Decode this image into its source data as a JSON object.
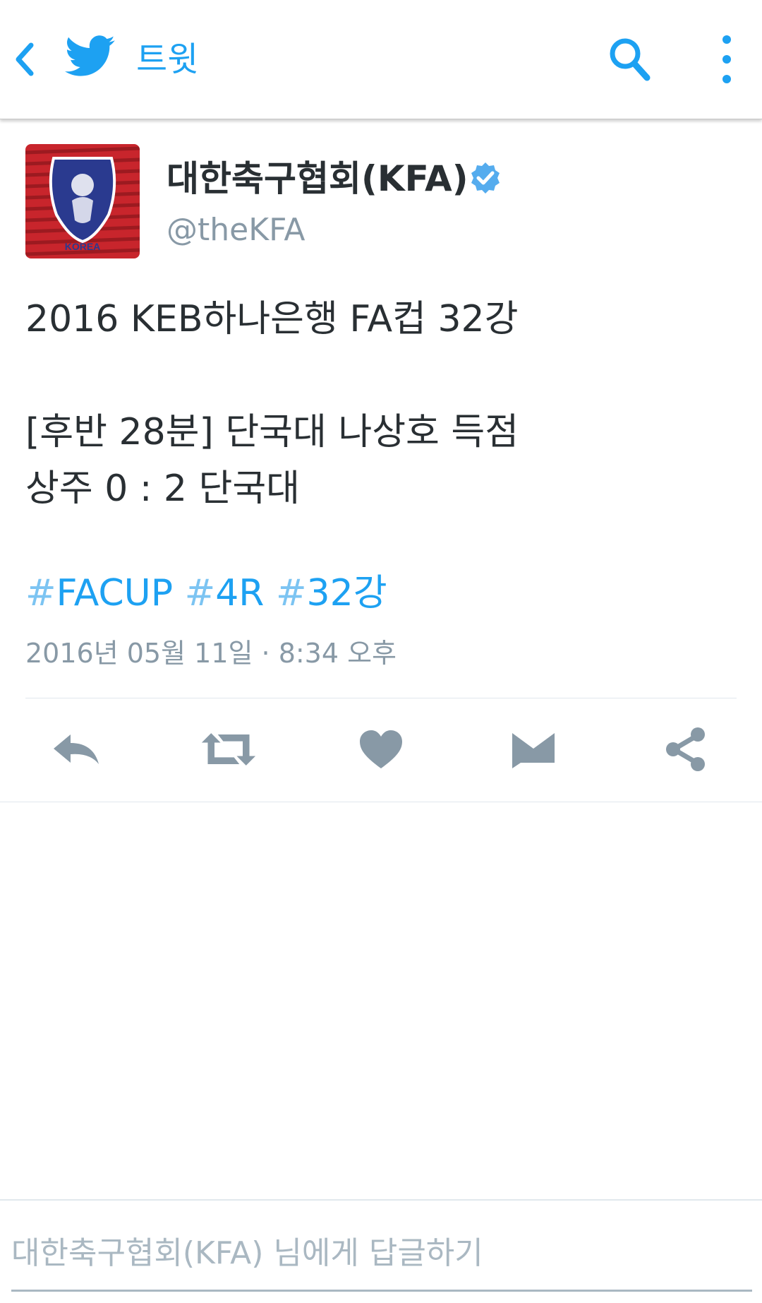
{
  "app": {
    "screen_title": "트윗",
    "accent_color": "#1da1f2"
  },
  "tweet": {
    "author_name": "대한축구협회(KFA)",
    "handle": "@theKFA",
    "verified": true,
    "avatar_text": "KOREA",
    "text_lines": [
      "2016 KEB하나은행 FA컵 32강",
      "[후반 28분] 단국대 나상호 득점",
      "상주 0 : 2 단국대"
    ],
    "hashtags": [
      {
        "hash": "#",
        "tag": "FACUP"
      },
      {
        "hash": "#",
        "tag": "4R"
      },
      {
        "hash": "#",
        "tag": "32강"
      }
    ],
    "timestamp": "2016년 05월 11일 · 8:34 오후"
  },
  "actions": [
    {
      "name": "reply",
      "icon": "reply-icon"
    },
    {
      "name": "retweet",
      "icon": "retweet-icon"
    },
    {
      "name": "like",
      "icon": "heart-icon"
    },
    {
      "name": "direct-message",
      "icon": "envelope-icon"
    },
    {
      "name": "share",
      "icon": "share-icon"
    }
  ],
  "reply_box": {
    "placeholder": "대한축구협회(KFA) 님에게 답글하기"
  },
  "colors": {
    "icon_gray": "#8899a6",
    "text_dark": "#292f33",
    "verified_blue": "#55acee",
    "avatar_red": "#c8252c"
  }
}
